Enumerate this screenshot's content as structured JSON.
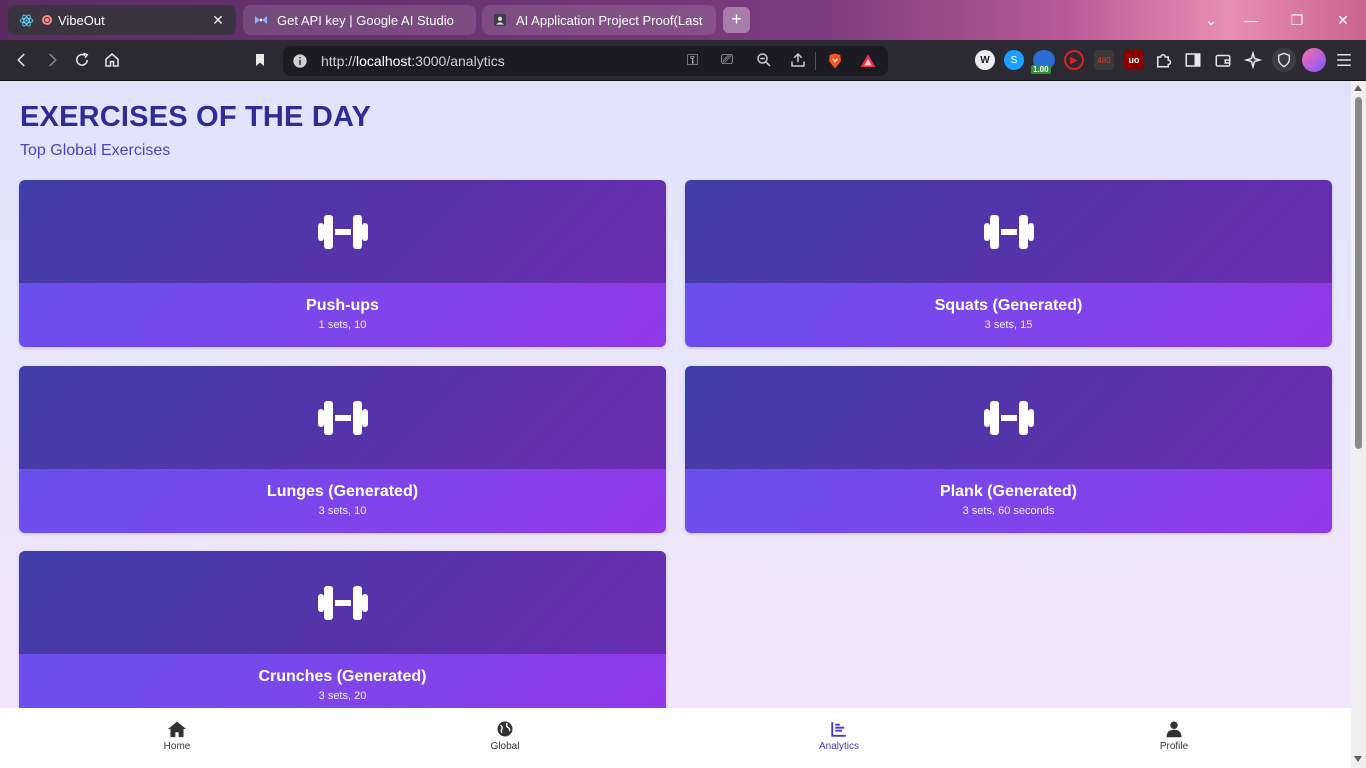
{
  "browser": {
    "tabs": [
      {
        "title": "VibeOut",
        "favicon": "react-icon",
        "active": true
      },
      {
        "title": "Get API key | Google AI Studio",
        "favicon": "ai-studio-icon",
        "active": false
      },
      {
        "title": "AI Application Project Proof(Last da",
        "favicon": "contact-icon",
        "active": false
      }
    ],
    "new_tab_label": "+",
    "url_prefix": "http://",
    "url_host": "localhost",
    "url_path": ":3000/analytics",
    "extension_badge": "1.00",
    "extension_480": "480"
  },
  "page": {
    "title": "EXERCISES OF THE DAY",
    "subtitle": "Top Global Exercises"
  },
  "exercises": [
    {
      "name": "Push-ups",
      "detail": "1 sets, 10"
    },
    {
      "name": "Squats (Generated)",
      "detail": "3 sets, 15"
    },
    {
      "name": "Lunges (Generated)",
      "detail": "3 sets, 10"
    },
    {
      "name": "Plank (Generated)",
      "detail": "3 sets, 60 seconds"
    },
    {
      "name": "Crunches (Generated)",
      "detail": "3 sets, 20"
    }
  ],
  "nav": {
    "home": "Home",
    "global": "Global",
    "analytics": "Analytics",
    "profile": "Profile",
    "active": "analytics"
  },
  "colors": {
    "accent": "#4338ca",
    "title": "#2e2c96",
    "card_top": "#5633a8",
    "card_bottom": "#7c46ea"
  }
}
